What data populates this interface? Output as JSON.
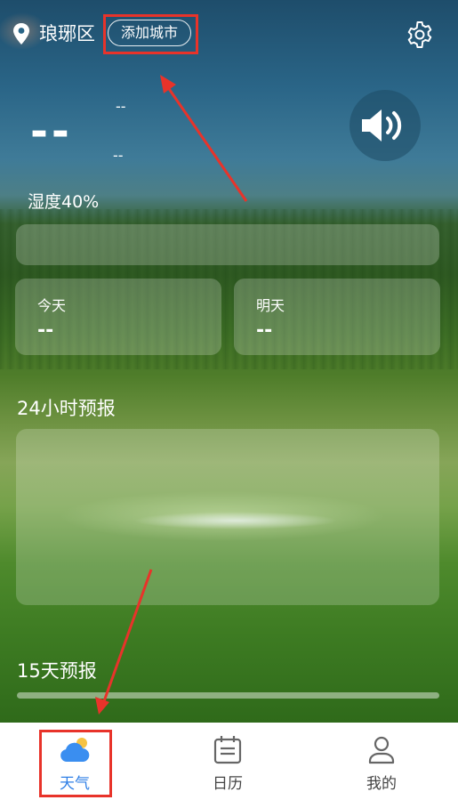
{
  "header": {
    "city": "琅琊区",
    "add_city_label": "添加城市",
    "location_icon": "location-pin-icon",
    "settings_icon": "gear-icon"
  },
  "current": {
    "temperature": "--",
    "sub_line_1": "--",
    "sub_line_2": "--",
    "speaker_icon": "speaker-icon",
    "humidity": "湿度40%"
  },
  "days": [
    {
      "label": "今天",
      "value": "--"
    },
    {
      "label": "明天",
      "value": "--"
    }
  ],
  "sections": {
    "hourly_title": "24小时预报",
    "daily_title": "15天预报"
  },
  "tabs": [
    {
      "label": "天气",
      "icon": "weather-cloud-icon",
      "active": true
    },
    {
      "label": "日历",
      "icon": "calendar-icon",
      "active": false
    },
    {
      "label": "我的",
      "icon": "person-icon",
      "active": false
    }
  ],
  "colors": {
    "active_tab": "#2f7fe6",
    "highlight": "#e8332a"
  }
}
